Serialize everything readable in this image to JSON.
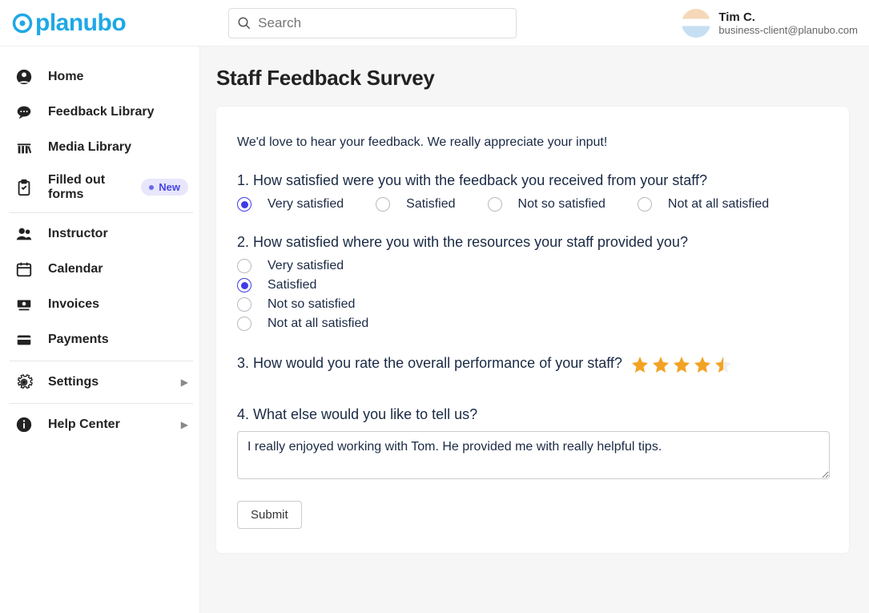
{
  "brand": "planubo",
  "search": {
    "placeholder": "Search"
  },
  "user": {
    "name": "Tim C.",
    "email": "business-client@planubo.com"
  },
  "sidebar": {
    "items": [
      {
        "label": "Home"
      },
      {
        "label": "Feedback Library"
      },
      {
        "label": "Media Library"
      },
      {
        "label": "Filled out forms",
        "badge": "New"
      },
      {
        "label": "Instructor"
      },
      {
        "label": "Calendar"
      },
      {
        "label": "Invoices"
      },
      {
        "label": "Payments"
      },
      {
        "label": "Settings"
      },
      {
        "label": "Help Center"
      }
    ]
  },
  "page": {
    "title": "Staff Feedback Survey",
    "intro": "We'd love to hear your feedback. We really appreciate your input!",
    "q1": {
      "text": "1. How satisfied were you with the feedback you received from your staff?",
      "options": [
        "Very satisfied",
        "Satisfied",
        "Not so satisfied",
        "Not at all satisfied"
      ],
      "selected": 0
    },
    "q2": {
      "text": "2. How satisfied where you with the resources your staff provided you?",
      "options": [
        "Very satisfied",
        "Satisfied",
        "Not so satisfied",
        "Not at all satisfied"
      ],
      "selected": 1
    },
    "q3": {
      "text": "3. How would you rate the overall performance of your staff?",
      "rating": 4.5,
      "max": 5
    },
    "q4": {
      "text": "4. What else would you like to tell us?",
      "value": "I really enjoyed working with Tom. He provided me with really helpful tips."
    },
    "submit_label": "Submit"
  },
  "colors": {
    "accent": "#3f3be6",
    "brand": "#1ea8e6",
    "star": "#f2a324"
  }
}
